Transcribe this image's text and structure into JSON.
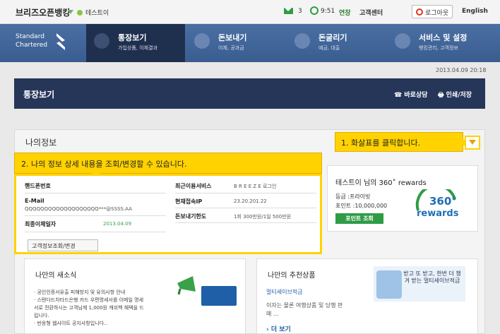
{
  "topbar": {
    "brand": "브리즈오픈뱅킹",
    "user": "테스트이",
    "mail_count": "3",
    "time": "9:51",
    "extend": "연장",
    "support": "고객센터",
    "logout": "로그아웃",
    "language": "English"
  },
  "logo": {
    "line1": "Standard",
    "line2": "Chartered"
  },
  "nav": [
    {
      "title": "통장보기",
      "sub": "가입상품, 이체결과"
    },
    {
      "title": "돈보내기",
      "sub": "이체, 공과금"
    },
    {
      "title": "돈굴리기",
      "sub": "예금, 대출"
    },
    {
      "title": "서비스 및 설정",
      "sub": "뱅킹관리, 고객정보"
    }
  ],
  "date": "2013.04.09 20:18",
  "titlebar": {
    "title": "통장보기",
    "counsel": "바로상담",
    "print": "인쇄/저장"
  },
  "myinfo": {
    "title": "나의정보",
    "callout1": "1. 화살표를 클릭합니다.",
    "callout2": "2. 나의 정보 상세 내용을 조회/변경할 수 있습니다.",
    "phone_label": "핸드폰번호",
    "email_label": "E-Mail",
    "email_value": "QQQQQQQQQQQQQQQQQQQ***@SSSS.AA",
    "last_transfer_label": "최종이체일자",
    "last_transfer_value": "2013.04.09",
    "recent_service_label": "최근이용서비스",
    "recent_service_value": "B R E E Z E  로그인",
    "ip_label": "현재접속IP",
    "ip_value": "23.20.201.22",
    "limit_label": "돈보내기한도",
    "limit_value": "1회 300만원/1일 500만원",
    "edit_button": "고객정보조회/변경"
  },
  "rewards": {
    "title": "테스트이 님의 360˚ rewards",
    "grade": "등급 :프라이빗",
    "points": "포인트 :10,000,000",
    "button": "포인트 조회",
    "logo_num": "360°",
    "logo_word": "rewards"
  },
  "news": {
    "title": "나만의 새소식",
    "items": [
      "· 공인인증서유출 피해방지 및 유의사항 안내",
      "· 스탠다드차타드은행 카드 우편명세서를 이메일 명세",
      "  서로 전환하시는 고객님께 1,000원 캐쉬백 혜택을 드",
      "  립니다.",
      "· 반응형 웹사이트 공지사항입니다.."
    ]
  },
  "recommend": {
    "title": "나만의 추천상품",
    "product": "멀티세이브적금",
    "desc": "이자는 물론 여행상품 및 당행 판매 ...",
    "more": "› 더 보기",
    "banner": "받고 또 받고, 한번 더 챙겨 받는 멀티세이브적금"
  }
}
